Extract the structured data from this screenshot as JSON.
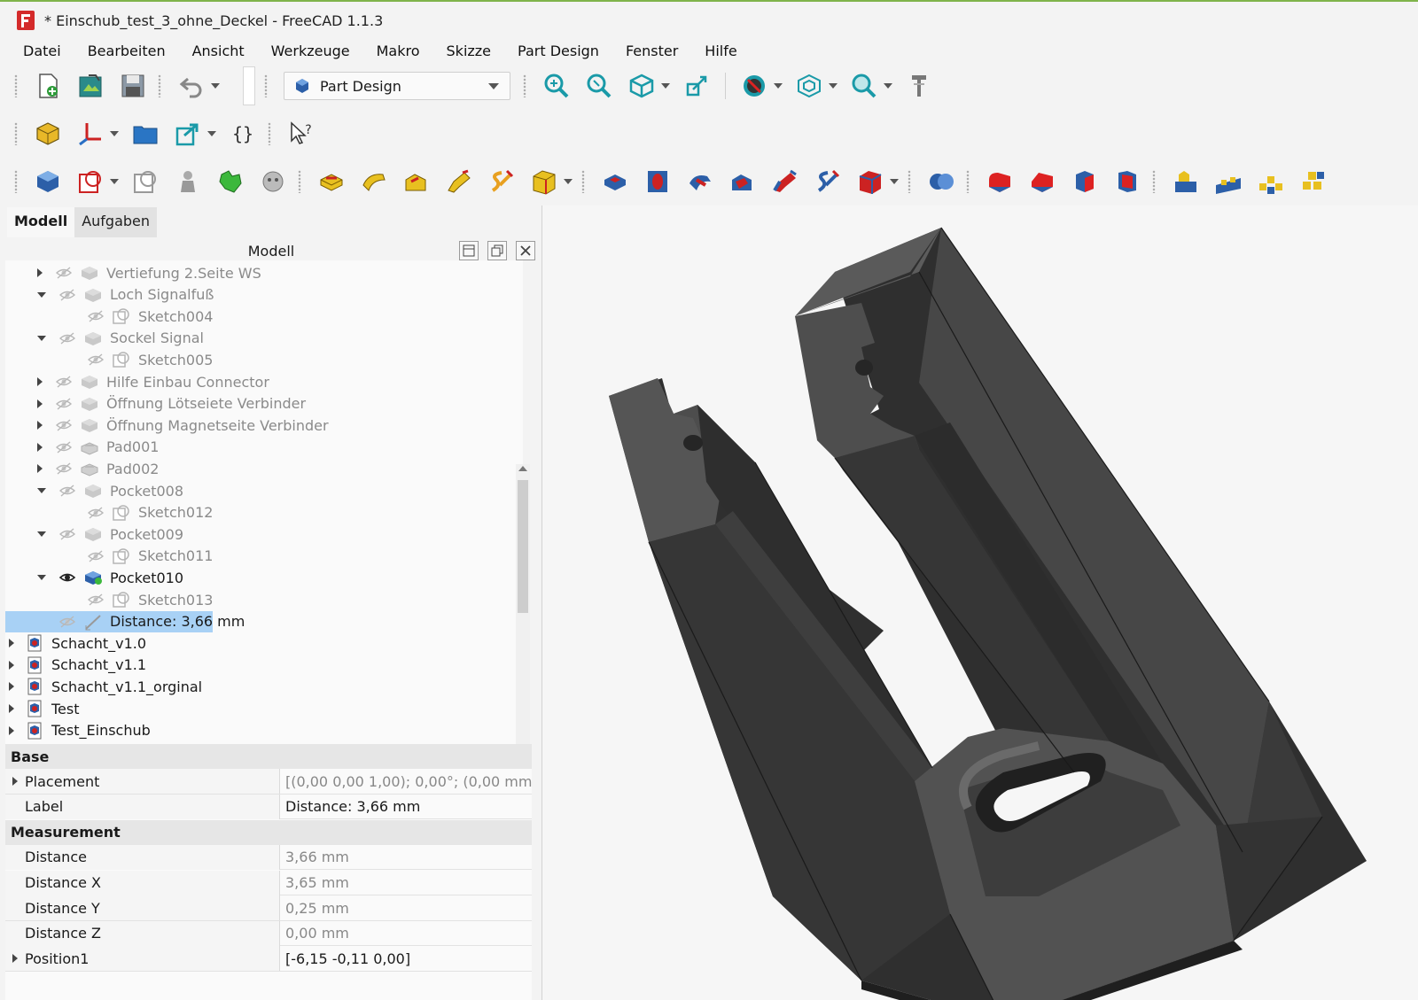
{
  "window": {
    "title": "* Einschub_test_3_ohne_Deckel - FreeCAD 1.1.3"
  },
  "menu": [
    "Datei",
    "Bearbeiten",
    "Ansicht",
    "Werkzeuge",
    "Makro",
    "Skizze",
    "Part Design",
    "Fenster",
    "Hilfe"
  ],
  "workbench": {
    "selected": "Part Design"
  },
  "panel": {
    "tabs": [
      {
        "label": "Modell",
        "active": true
      },
      {
        "label": "Aufgaben",
        "active": false
      }
    ],
    "header": "Modell"
  },
  "tree": [
    {
      "label": "Vertiefung 2.Seite WS",
      "level": 2,
      "expander": "collapsed",
      "visible": false,
      "icon": "pocket-feature-icon"
    },
    {
      "label": "Loch Signalfuß",
      "level": 2,
      "expander": "expanded",
      "visible": false,
      "icon": "pocket-feature-icon"
    },
    {
      "label": "Sketch004",
      "level": 3,
      "expander": "none",
      "visible": false,
      "icon": "sketch-icon"
    },
    {
      "label": "Sockel Signal",
      "level": 2,
      "expander": "expanded",
      "visible": false,
      "icon": "pocket-feature-icon"
    },
    {
      "label": "Sketch005",
      "level": 3,
      "expander": "none",
      "visible": false,
      "icon": "sketch-icon"
    },
    {
      "label": "Hilfe Einbau Connector",
      "level": 2,
      "expander": "collapsed",
      "visible": false,
      "icon": "pocket-feature-icon"
    },
    {
      "label": "Öffnung Lötseiete Verbinder",
      "level": 2,
      "expander": "collapsed",
      "visible": false,
      "icon": "pocket-feature-icon"
    },
    {
      "label": "Öffnung Magnetseite Verbinder",
      "level": 2,
      "expander": "collapsed",
      "visible": false,
      "icon": "pocket-feature-icon"
    },
    {
      "label": "Pad001",
      "level": 2,
      "expander": "collapsed",
      "visible": false,
      "icon": "pad-feature-icon"
    },
    {
      "label": "Pad002",
      "level": 2,
      "expander": "collapsed",
      "visible": false,
      "icon": "pad-feature-icon"
    },
    {
      "label": "Pocket008",
      "level": 2,
      "expander": "expanded",
      "visible": false,
      "icon": "pocket-feature-icon"
    },
    {
      "label": "Sketch012",
      "level": 3,
      "expander": "none",
      "visible": false,
      "icon": "sketch-icon"
    },
    {
      "label": "Pocket009",
      "level": 2,
      "expander": "expanded",
      "visible": false,
      "icon": "pocket-feature-icon"
    },
    {
      "label": "Sketch011",
      "level": 3,
      "expander": "none",
      "visible": false,
      "icon": "sketch-icon"
    },
    {
      "label": "Pocket010",
      "level": 2,
      "expander": "expanded",
      "visible": true,
      "icon": "pocket-tip-icon"
    },
    {
      "label": "Sketch013",
      "level": 3,
      "expander": "none",
      "visible": false,
      "icon": "sketch-icon"
    },
    {
      "label": "Distance: 3,66 mm",
      "level": 1,
      "expander": "none",
      "visible": false,
      "icon": "measure-icon",
      "selected": true
    },
    {
      "label": "Schacht_v1.0",
      "level": 0,
      "expander": "collapsed",
      "visible": null,
      "icon": "body-icon"
    },
    {
      "label": "Schacht_v1.1",
      "level": 0,
      "expander": "collapsed",
      "visible": null,
      "icon": "body-icon"
    },
    {
      "label": "Schacht_v1.1_orginal",
      "level": 0,
      "expander": "collapsed",
      "visible": null,
      "icon": "body-icon"
    },
    {
      "label": "Test",
      "level": 0,
      "expander": "collapsed",
      "visible": null,
      "icon": "body-icon"
    },
    {
      "label": "Test_Einschub",
      "level": 0,
      "expander": "collapsed",
      "visible": null,
      "icon": "body-icon"
    }
  ],
  "properties": {
    "groups": [
      {
        "name": "Base",
        "rows": [
          {
            "name": "Placement",
            "value": "[(0,00 0,00 1,00); 0,00°; (0,00 mm  0,...",
            "expandable": true,
            "readonly": true
          },
          {
            "name": "Label",
            "value": "Distance: 3,66 mm",
            "expandable": false,
            "readonly": false
          }
        ]
      },
      {
        "name": "Measurement",
        "rows": [
          {
            "name": "Distance",
            "value": "3,66 mm",
            "expandable": false,
            "readonly": true
          },
          {
            "name": "Distance X",
            "value": "3,65 mm",
            "expandable": false,
            "readonly": true
          },
          {
            "name": "Distance Y",
            "value": "0,25 mm",
            "expandable": false,
            "readonly": true
          },
          {
            "name": "Distance Z",
            "value": "0,00 mm",
            "expandable": false,
            "readonly": true
          },
          {
            "name": "Position1",
            "value": "[-6,15 -0,11 0,00]",
            "expandable": true,
            "readonly": false
          }
        ]
      }
    ]
  },
  "colors": {
    "accent": "#a8d1f5",
    "model": "#3d3d3d",
    "model_light": "#5a5a5a",
    "model_dark": "#2a2a2a",
    "titlebar_stripe": "#7fb44a"
  }
}
